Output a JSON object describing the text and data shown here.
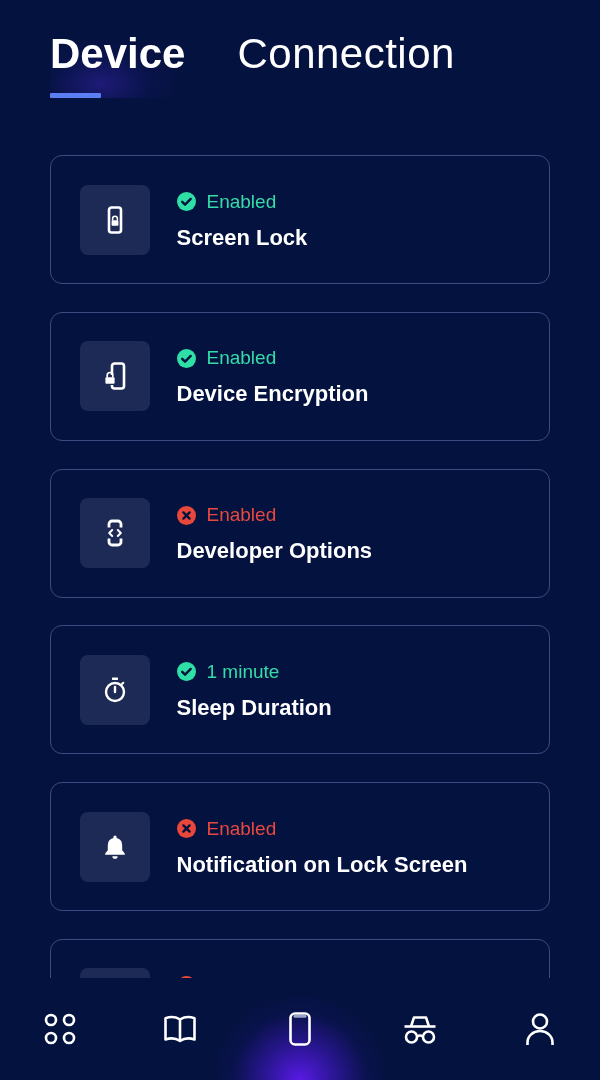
{
  "tabs": [
    {
      "label": "Device",
      "selected": true
    },
    {
      "label": "Connection",
      "selected": false
    }
  ],
  "settings": [
    {
      "status": "Enabled",
      "secure": true,
      "title": "Screen Lock"
    },
    {
      "status": "Enabled",
      "secure": true,
      "title": "Device Encryption"
    },
    {
      "status": "Enabled",
      "secure": false,
      "title": "Developer Options"
    },
    {
      "status": "1 minute",
      "secure": true,
      "title": "Sleep Duration"
    },
    {
      "status": "Enabled",
      "secure": false,
      "title": "Notification on Lock Screen"
    },
    {
      "secure": false
    }
  ],
  "bottom_nav": [
    {
      "selected": false
    },
    {
      "selected": false
    },
    {
      "selected": true
    },
    {
      "selected": false
    },
    {
      "selected": false
    }
  ]
}
